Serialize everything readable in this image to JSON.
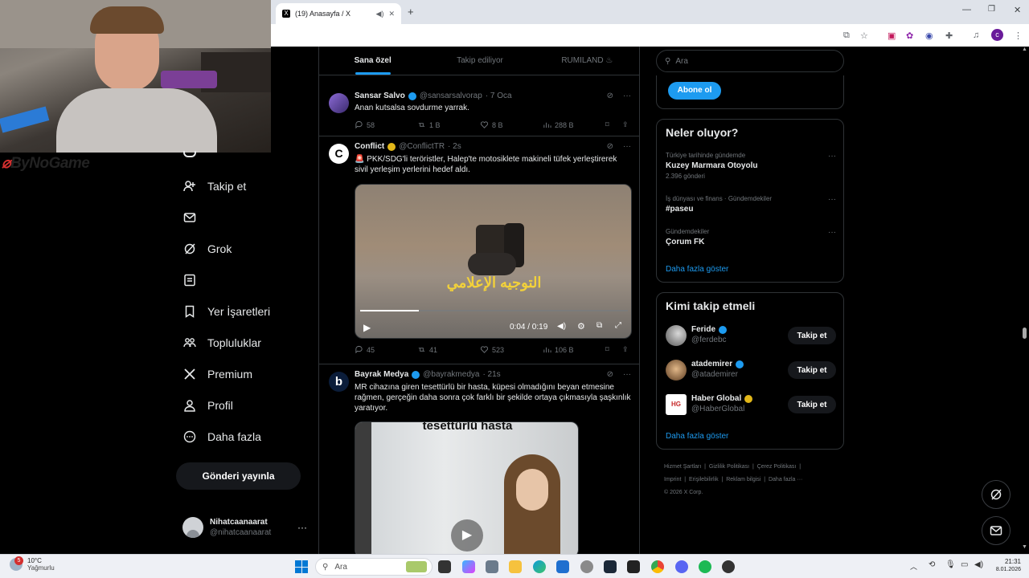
{
  "browser": {
    "tab_title": "(19) Anasayfa / X",
    "new_tab": "+",
    "profile_initial": "c"
  },
  "stream": {
    "watermark": "ByNoGame"
  },
  "nav": {
    "items": [
      {
        "label": "Takip et",
        "icon": "add-user-icon"
      },
      {
        "label": "",
        "icon": "mail-icon"
      },
      {
        "label": "Grok",
        "icon": "grok-icon"
      },
      {
        "label": "",
        "icon": "list-icon"
      },
      {
        "label": "Yer İşaretleri",
        "icon": "bookmark-icon"
      },
      {
        "label": "Topluluklar",
        "icon": "communities-icon"
      },
      {
        "label": "Premium",
        "icon": "x-logo-icon"
      },
      {
        "label": "Profil",
        "icon": "person-icon"
      },
      {
        "label": "Daha fazla",
        "icon": "more-circle-icon"
      }
    ],
    "post_button": "Gönderi yayınla",
    "user_name": "Nihatcaanaarat",
    "user_handle": "@nihatcaanaarat",
    "user_more": "···"
  },
  "feed": {
    "tabs": [
      "Sana özel",
      "Takip ediliyor",
      "RUMILAND ♨"
    ],
    "tweets": [
      {
        "name": "Sansar Salvo",
        "handle": "@sansarsalvorap",
        "time": "· 7 Oca",
        "text": "Anan kutsalsa sovdurme yarrak.",
        "replies": "58",
        "retweets": "1 B",
        "likes": "8 B",
        "views": "288 B"
      },
      {
        "name": "Conflict",
        "handle": "@ConflictTR",
        "time": "· 2s",
        "text": "🚨 PKK/SDG'li teröristler, Halep'te motosiklete makineli tüfek yerleştirerek sivil yerleşim yerlerini hedef aldı.",
        "video_caption": "التوجيه الإعلامي",
        "video_time": "0:04 / 0:19",
        "video_progress": 0.22,
        "replies": "45",
        "retweets": "41",
        "likes": "523",
        "views": "106 B"
      },
      {
        "name": "Bayrak Medya",
        "handle": "@bayrakmedya",
        "time": "· 21s",
        "text": "MR cihazına giren tesettürlü bir hasta, küpesi olmadığını beyan etmesine rağmen, gerçeğin daha sonra çok farklı bir şekilde ortaya çıkmasıyla şaşkınlık yaratıyor.",
        "video_caption": "tesettürlü hasta"
      }
    ]
  },
  "right": {
    "search_placeholder": "Ara",
    "subscribe": "Abone ol",
    "trends_title": "Neler oluyor?",
    "trends": [
      {
        "category": "Türkiye tarihinde gündemde",
        "name": "Kuzey Marmara Otoyolu",
        "count": "2.396 gönderi"
      },
      {
        "category": "İş dünyası ve finans · Gündemdekiler",
        "name": "#paseu",
        "count": ""
      },
      {
        "category": "Gündemdekiler",
        "name": "Çorum FK",
        "count": ""
      }
    ],
    "trends_more": "Daha fazla göster",
    "follow_title": "Kimi takip etmeli",
    "follow": [
      {
        "name": "Feride",
        "handle": "@ferdebc",
        "button": "Takip et"
      },
      {
        "name": "atademirer",
        "handle": "@atademirer",
        "button": "Takip et"
      },
      {
        "name": "Haber Global",
        "handle": "@HaberGlobal",
        "button": "Takip et"
      }
    ],
    "follow_more": "Daha fazla göster",
    "footer": [
      "Hizmet Şartları",
      "Gizlilik Politikası",
      "Çerez Politikası",
      "Imprint",
      "Erişilebilirlik",
      "Reklam bilgisi",
      "Daha fazla ···",
      "© 2026 X Corp."
    ]
  },
  "taskbar": {
    "weather_temp": "10°C",
    "weather_desc": "Yağmurlu",
    "search": "Ara",
    "time": "21:31",
    "date": "8.01.2026",
    "notif_badge": "5"
  },
  "colors": {
    "accent": "#1d9bf0",
    "bg": "#000000",
    "border": "#2f3336"
  }
}
